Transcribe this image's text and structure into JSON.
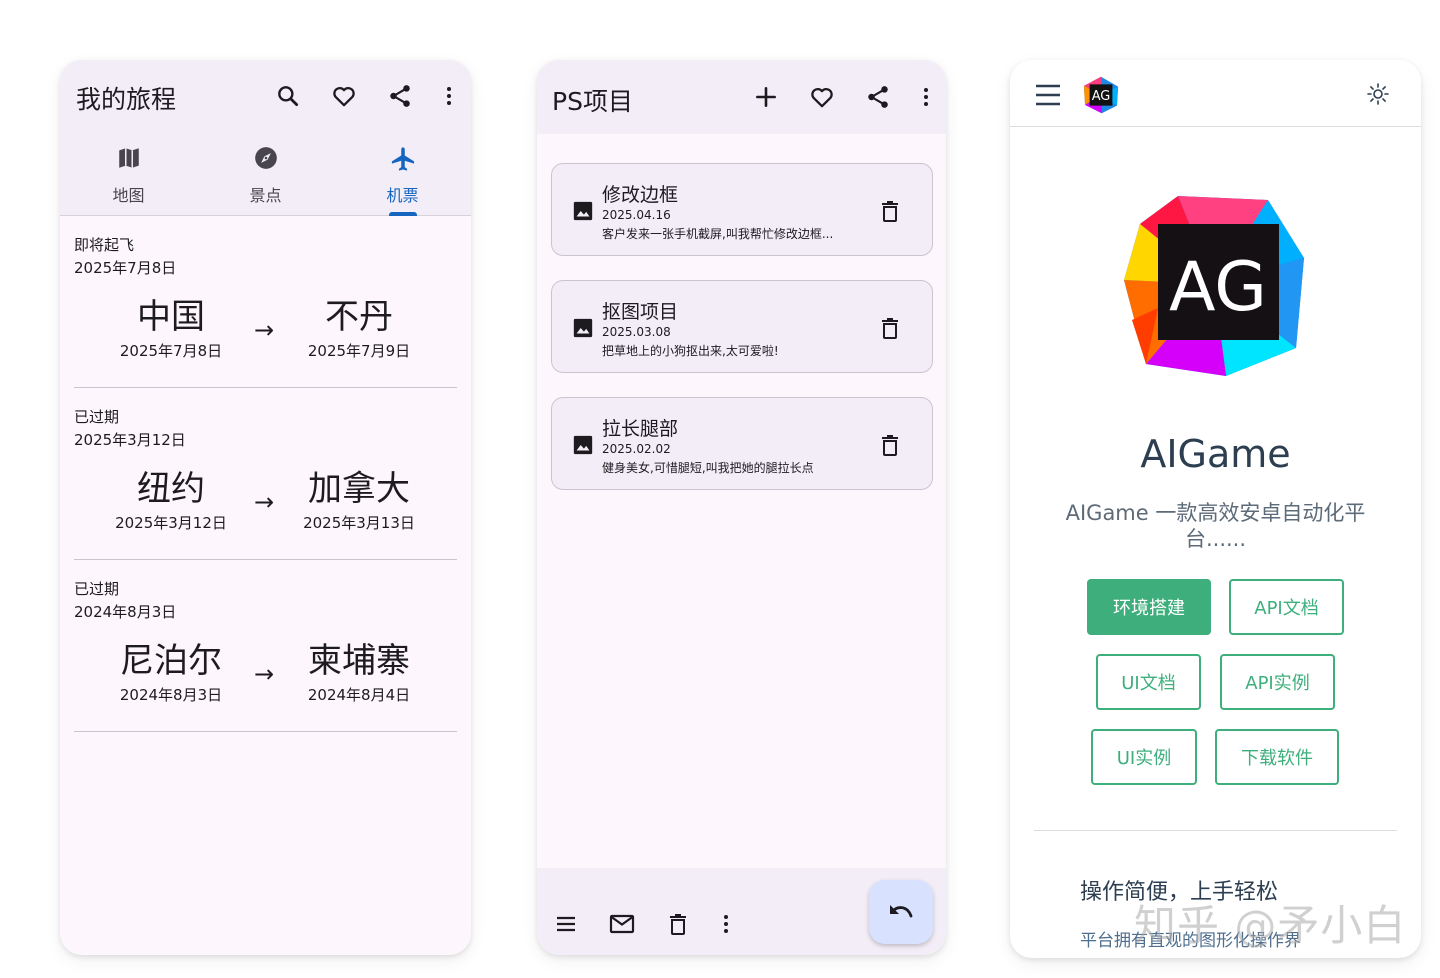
{
  "trips_screen": {
    "title": "我的旅程",
    "tabs": [
      {
        "label": "地图",
        "icon": "map-icon",
        "active": false
      },
      {
        "label": "景点",
        "icon": "compass-icon",
        "active": false
      },
      {
        "label": "机票",
        "icon": "airplane-icon",
        "active": true
      }
    ],
    "trips": [
      {
        "status": "即将起飞",
        "date": "2025年7月8日",
        "from": "中国",
        "from_date": "2025年7月8日",
        "to": "不丹",
        "to_date": "2025年7月9日"
      },
      {
        "status": "已过期",
        "date": "2025年3月12日",
        "from": "纽约",
        "from_date": "2025年3月12日",
        "to": "加拿大",
        "to_date": "2025年3月13日"
      },
      {
        "status": "已过期",
        "date": "2024年8月3日",
        "from": "尼泊尔",
        "from_date": "2024年8月3日",
        "to": "柬埔寨",
        "to_date": "2024年8月4日"
      }
    ],
    "arrow": "→"
  },
  "ps_screen": {
    "title": "PS项目",
    "projects": [
      {
        "name": "修改边框",
        "date": "2025.04.16",
        "desc": "客户发来一张手机截屏,叫我帮忙修改边框..."
      },
      {
        "name": "抠图项目",
        "date": "2025.03.08",
        "desc": "把草地上的小狗抠出来,太可爱啦!"
      },
      {
        "name": "拉长腿部",
        "date": "2025.02.02",
        "desc": "健身美女,可惜腿短,叫我把她的腿拉长点"
      }
    ]
  },
  "docs_screen": {
    "logo_text": "AG",
    "hero_title": "AIGame",
    "tagline": "AIGame 一款高效安卓自动化平台......",
    "buttons": {
      "env_setup": "环境搭建",
      "api_docs": "API文档",
      "ui_docs": "UI文档",
      "api_examples": "API实例",
      "ui_examples": "UI实例",
      "download": "下载软件"
    },
    "feature_title": "操作简便，上手轻松",
    "feature_desc": "平台拥有直观的图形化操作界"
  },
  "watermark": "知乎 @矛小白",
  "colors": {
    "accent_blue": "#1565c0",
    "brand_green": "#3eaf7c",
    "surface": "#f3edf7",
    "fab": "#d8e2ff"
  }
}
